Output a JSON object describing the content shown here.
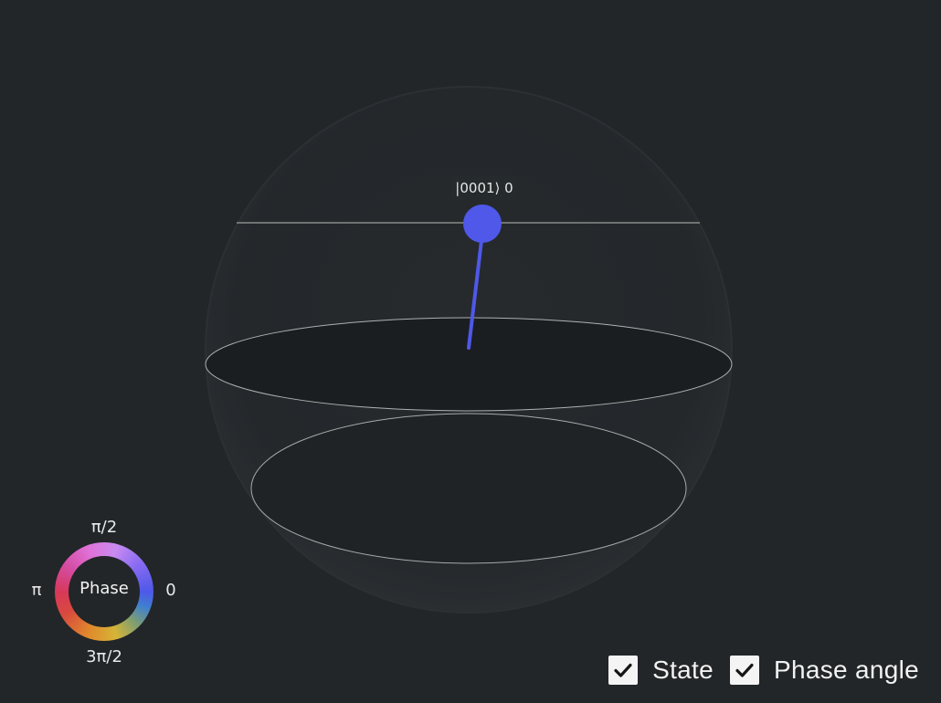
{
  "qsphere": {
    "state_label": "|0001⟩ 0",
    "state_color": "#4f58e8"
  },
  "phase_wheel": {
    "center_label": "Phase",
    "tick_top": "π/2",
    "tick_bottom": "3π/2",
    "tick_left": "π",
    "tick_right": "0"
  },
  "controls": {
    "state": {
      "label": "State",
      "checked": true,
      "icon": "checkmark-icon"
    },
    "phase_angle": {
      "label": "Phase angle",
      "checked": true,
      "icon": "checkmark-icon"
    }
  },
  "colors": {
    "background": "#222629",
    "state_vector": "#4f58e8",
    "outline": "#a8a8a8"
  }
}
